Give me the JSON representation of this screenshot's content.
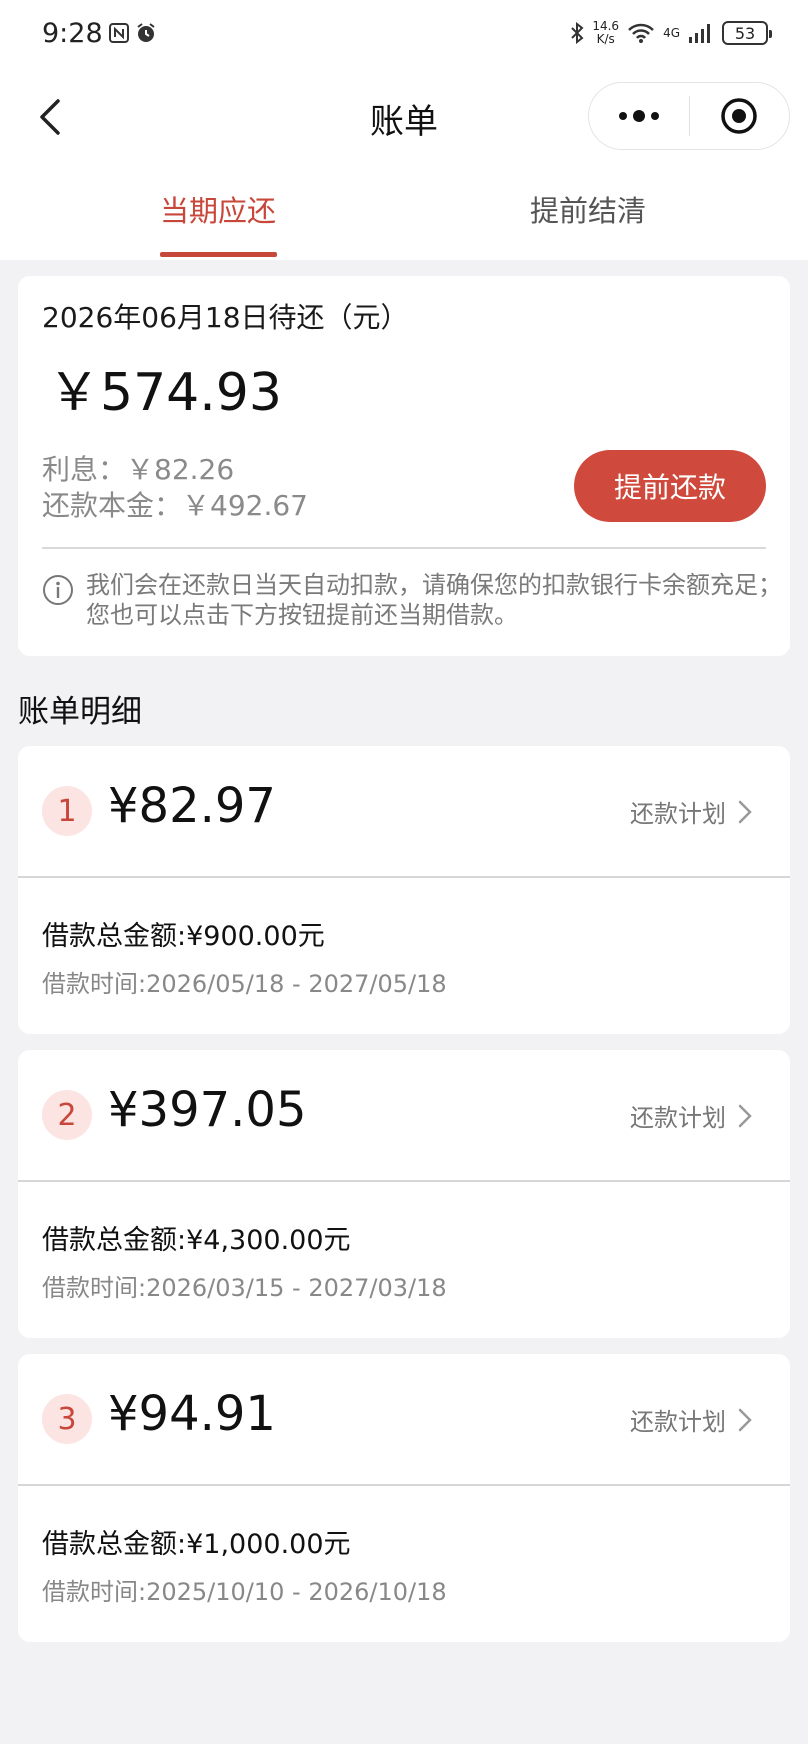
{
  "status_bar": {
    "time": "9:28",
    "net_speed_value": "14.6",
    "net_speed_unit": "K/s",
    "network_type": "4G",
    "battery": "53"
  },
  "nav": {
    "title": "账单"
  },
  "tabs": [
    {
      "label": "当期应还",
      "active": true
    },
    {
      "label": "提前结清",
      "active": false
    }
  ],
  "summary": {
    "due_label": "2026年06月18日待还（元）",
    "due_amount": "￥574.93",
    "interest": "利息：￥82.26",
    "principal": "还款本金：￥492.67",
    "prepay_button": "提前还款",
    "notice": "我们会在还款日当天自动扣款，请确保您的扣款银行卡余额充足；您也可以点击下方按钮提前还当期借款。"
  },
  "details_title": "账单明细",
  "bills": [
    {
      "index": "1",
      "amount": "¥82.97",
      "plan_label": "还款计划",
      "total": "借款总金额:¥900.00元",
      "period": "借款时间:2026/05/18 - 2027/05/18"
    },
    {
      "index": "2",
      "amount": "¥397.05",
      "plan_label": "还款计划",
      "total": "借款总金额:¥4,300.00元",
      "period": "借款时间:2026/03/15 - 2027/03/18"
    },
    {
      "index": "3",
      "amount": "¥94.91",
      "plan_label": "还款计划",
      "total": "借款总金额:¥1,000.00元",
      "period": "借款时间:2025/10/10 - 2026/10/18"
    }
  ],
  "colors": {
    "accent": "#c8473b",
    "button": "#cf4a3c",
    "background": "#f2f2f4"
  }
}
